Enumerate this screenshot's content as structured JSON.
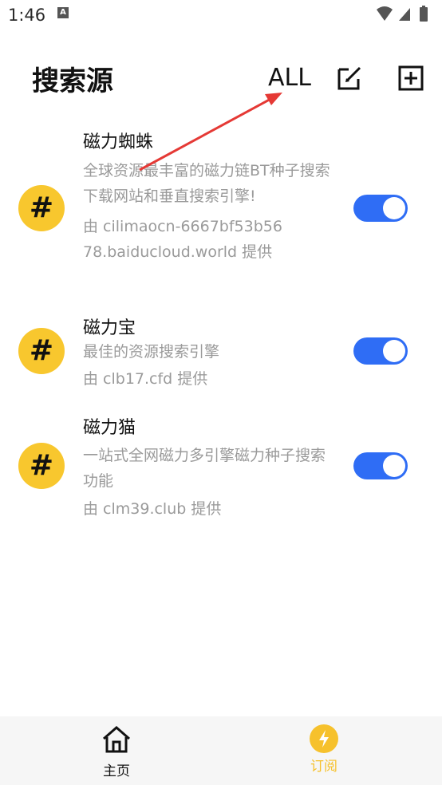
{
  "status_bar": {
    "time": "1:46",
    "notif_icon": "A"
  },
  "header": {
    "title": "搜索源",
    "all_label": "ALL"
  },
  "sources": [
    {
      "name": "磁力蜘蛛",
      "desc": "全球资源最丰富的磁力链BT种子搜索下载网站和垂直搜索引擎!",
      "provider": "由 cilimaocn-6667bf53b5678.baiducloud.world 提供",
      "enabled": true
    },
    {
      "name": "磁力宝",
      "desc": "最佳的资源搜索引擎",
      "provider": "由 clb17.cfd 提供",
      "enabled": true
    },
    {
      "name": "磁力猫",
      "desc": "一站式全网磁力多引擎磁力种子搜索功能",
      "provider": "由 clm39.club 提供",
      "enabled": true
    }
  ],
  "badge_symbol": "#",
  "bottom_nav": {
    "home_label": "主页",
    "sub_label": "订阅"
  },
  "colors": {
    "accent_blue": "#2f6df5",
    "badge_yellow": "#f8c72e",
    "arrow_red": "#e53935"
  }
}
